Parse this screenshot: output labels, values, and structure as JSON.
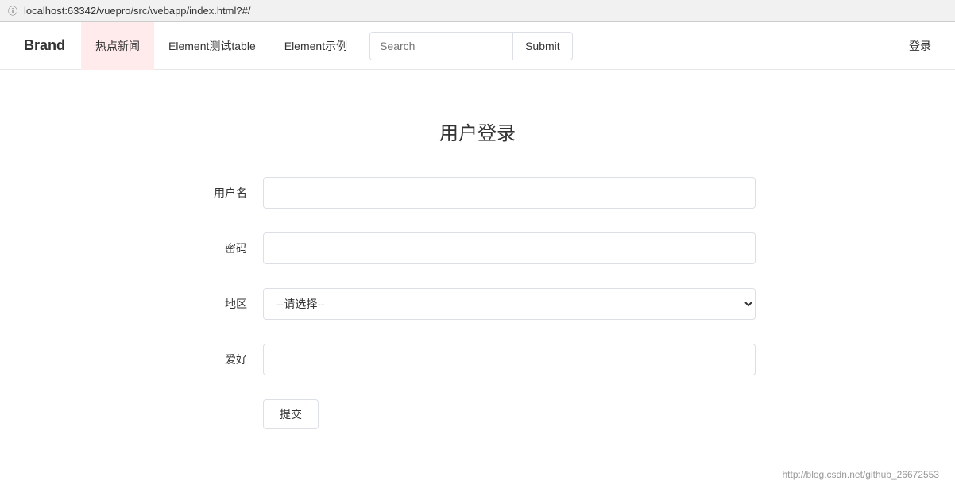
{
  "browser": {
    "url": "localhost:63342/vuepro/src/webapp/index.html?#/"
  },
  "navbar": {
    "brand": "Brand",
    "items": [
      {
        "label": "热点新闻",
        "active": true,
        "highlighted": true
      },
      {
        "label": "Element测试table",
        "active": false,
        "highlighted": false
      },
      {
        "label": "Element示例",
        "active": false,
        "highlighted": false
      }
    ],
    "search": {
      "placeholder": "Search",
      "value": ""
    },
    "submit_label": "Submit",
    "login_label": "登录"
  },
  "form": {
    "title": "用户登录",
    "fields": [
      {
        "label": "用户名",
        "type": "text",
        "placeholder": "",
        "name": "username"
      },
      {
        "label": "密码",
        "type": "password",
        "placeholder": "",
        "name": "password"
      },
      {
        "label": "地区",
        "type": "select",
        "placeholder": "--请选择--",
        "name": "region"
      },
      {
        "label": "爱好",
        "type": "text",
        "placeholder": "",
        "name": "hobby"
      }
    ],
    "submit_label": "提交"
  },
  "footer": {
    "text": "http://blog.csdn.net/github_26672553"
  }
}
